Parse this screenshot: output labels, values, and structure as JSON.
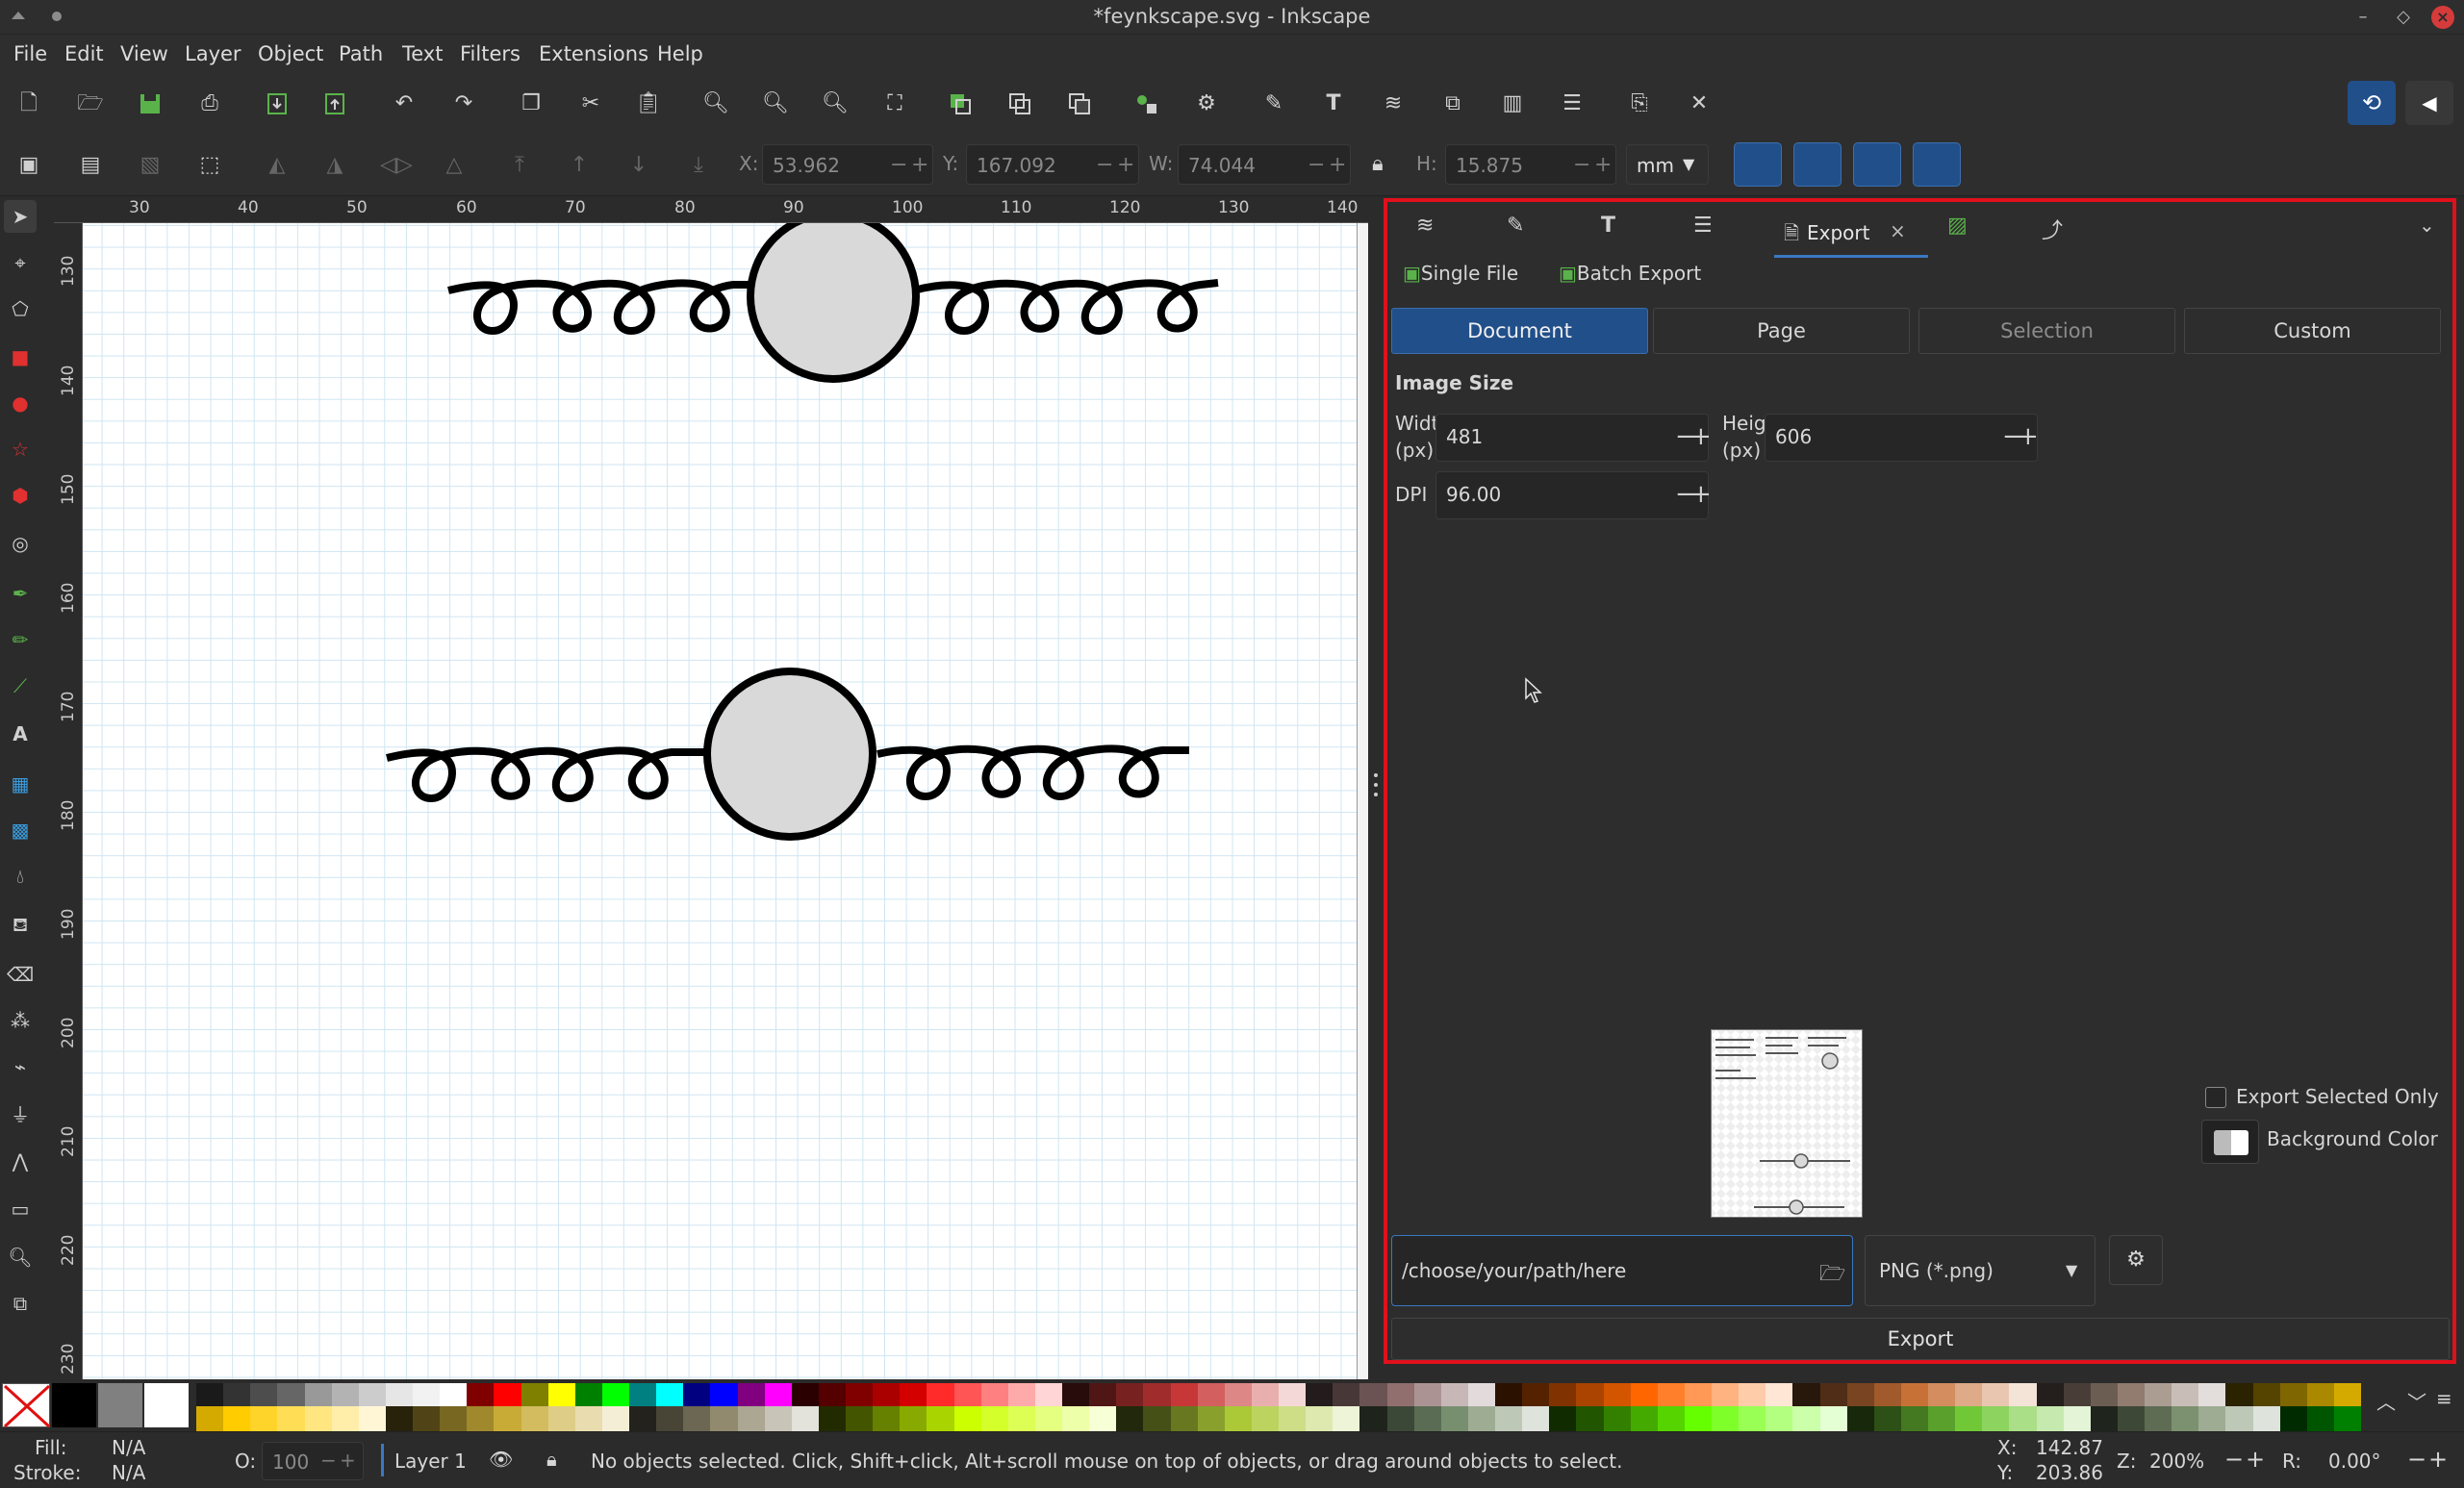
{
  "window": {
    "title": "*feynkscape.svg - Inkscape"
  },
  "menu": [
    "File",
    "Edit",
    "View",
    "Layer",
    "Object",
    "Path",
    "Text",
    "Filters",
    "Extensions",
    "Help"
  ],
  "controls": {
    "x_label": "X:",
    "x_value": "53.962",
    "y_label": "Y:",
    "y_value": "167.092",
    "w_label": "W:",
    "w_value": "74.044",
    "h_label": "H:",
    "h_value": "15.875",
    "unit": "mm"
  },
  "ruler": {
    "h_ticks": [
      "30",
      "40",
      "50",
      "60",
      "70",
      "80",
      "90",
      "100",
      "110",
      "120",
      "130",
      "140"
    ],
    "v_ticks": [
      "130",
      "140",
      "150",
      "160",
      "170",
      "180",
      "190",
      "200",
      "210",
      "220",
      "230"
    ]
  },
  "dock": {
    "tab_export_label": "Export",
    "subtab_single": "Single File",
    "subtab_batch": "Batch Export",
    "area": [
      "Document",
      "Page",
      "Selection",
      "Custom"
    ],
    "image_size_heading": "Image Size",
    "width_label": "Width",
    "width_unit": "(px)",
    "width_value": "481",
    "height_label": "Height",
    "height_unit": "(px)",
    "height_value": "606",
    "dpi_label": "DPI",
    "dpi_value": "96.00",
    "export_selected_only": "Export Selected Only",
    "background_color": "Background Color",
    "path_value": "/choose/your/path/here",
    "format_value": "PNG (*.png)",
    "export_button": "Export"
  },
  "status": {
    "fill_label": "Fill:",
    "fill_value": "N/A",
    "stroke_label": "Stroke:",
    "stroke_value": "N/A",
    "opacity_label": "O:",
    "opacity_value": "100",
    "layer": "Layer 1",
    "message": "No objects selected. Click, Shift+click, Alt+scroll mouse on top of objects, or drag around objects to select.",
    "x_label": "X:",
    "x_value": "142.87",
    "y_label": "Y:",
    "y_value": "203.86",
    "zoom_label": "Z:",
    "zoom_value": "200%",
    "rotate_label": "R:",
    "rotate_value": "0.00°"
  },
  "colors": {
    "accent": "#214f8a",
    "highlight_border": "#e0101c"
  },
  "icons": {
    "commands": [
      "new-document-icon",
      "open-icon",
      "save-icon",
      "print-icon",
      "import-icon",
      "export-icon",
      "undo-icon",
      "redo-icon",
      "copy-icon",
      "cut-icon",
      "paste-icon",
      "zoom-selection-icon",
      "zoom-drawing-icon",
      "zoom-page-icon",
      "zoom-width-icon",
      "duplicate-icon",
      "clone-icon",
      "unlink-clone-icon",
      "group-icon",
      "ungroup-icon",
      "fill-stroke-icon",
      "text-font-icon",
      "layers-icon",
      "xml-editor-icon",
      "symbols-icon",
      "align-distribute-icon",
      "document-properties-icon",
      "preferences-icon"
    ],
    "tools": [
      "selector-icon",
      "node-icon",
      "tweak-icon",
      "rectangle-icon",
      "ellipse-icon",
      "star-icon",
      "box3d-icon",
      "spiral-icon",
      "pen-icon",
      "pencil-icon",
      "calligraphy-icon",
      "text-icon",
      "gradient-icon",
      "mesh-icon",
      "dropper-icon",
      "paint-bucket-icon",
      "eraser-icon",
      "spray-icon",
      "connector-icon",
      "measure-icon",
      "lpe-icon",
      "pages-icon",
      "zoom-icon",
      "clone-tool-icon"
    ]
  }
}
